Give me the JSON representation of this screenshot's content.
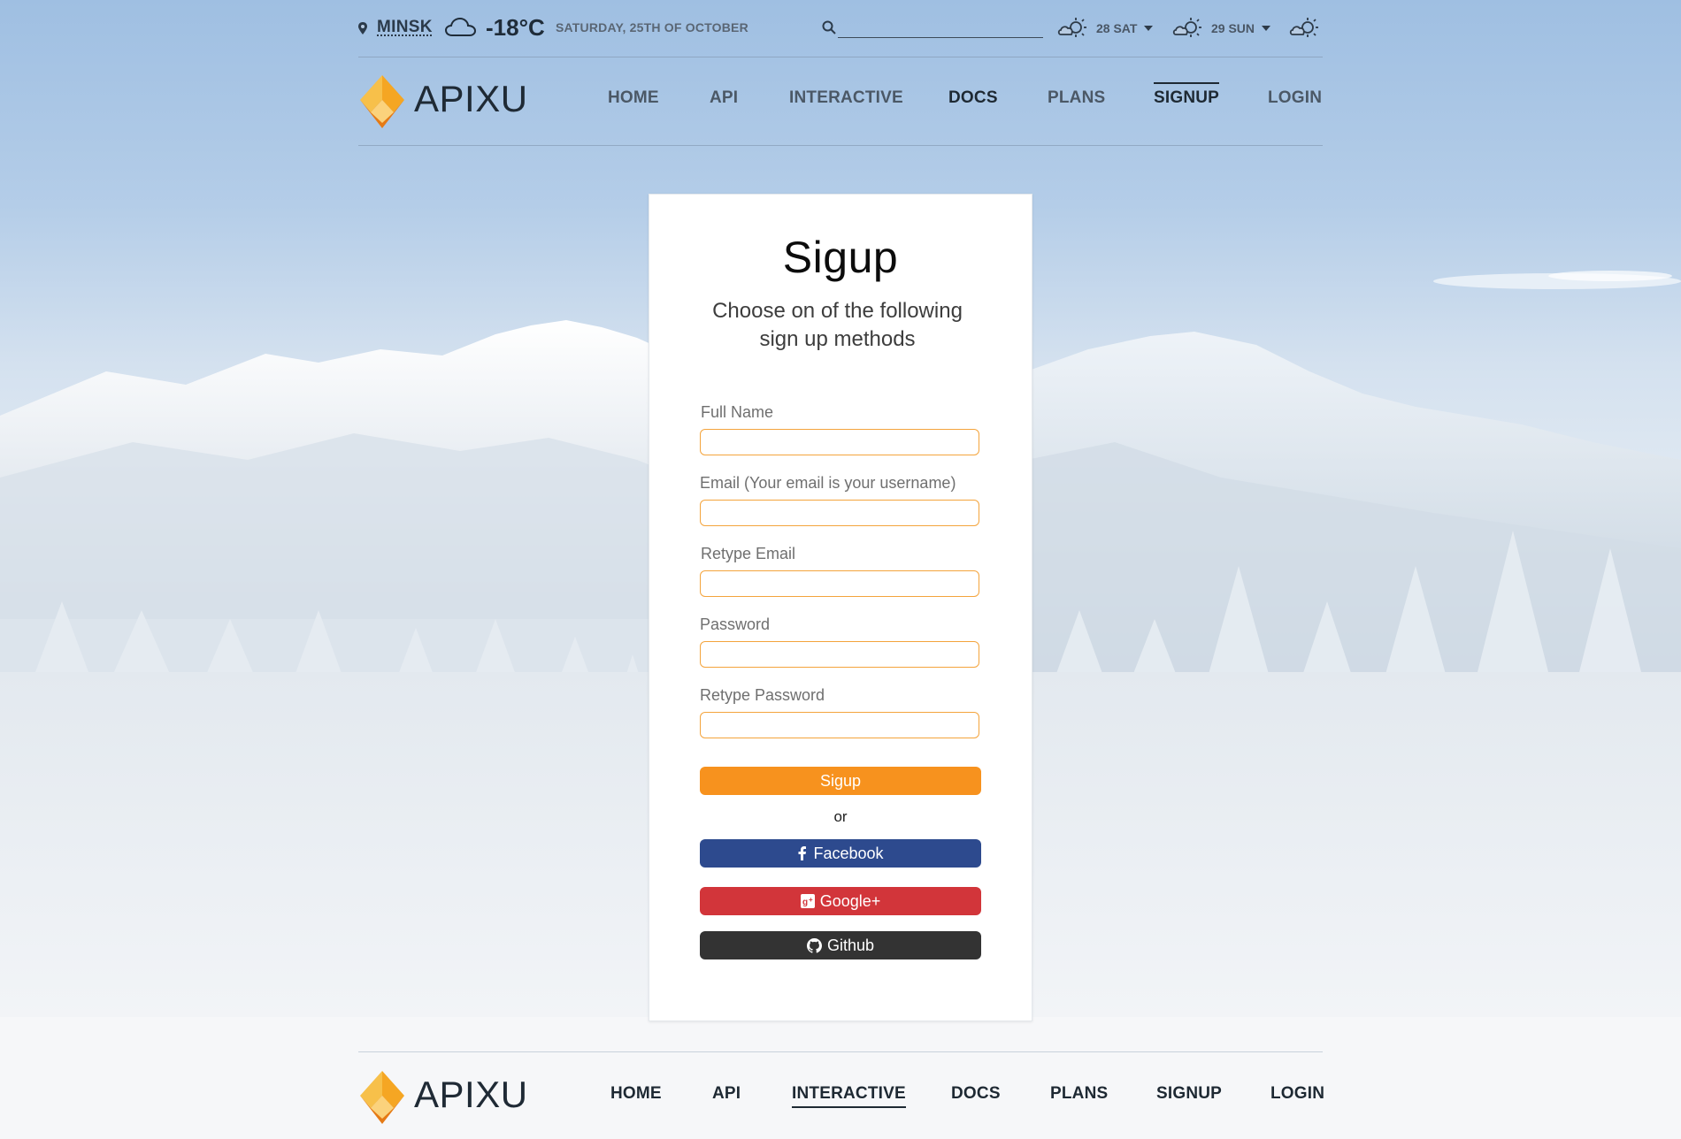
{
  "weather": {
    "city": "MINSK",
    "temperature": "-18°C",
    "date": "SATURDAY, 25TH OF OCTOBER",
    "forecast": [
      {
        "label": "28 SAT",
        "icon": "partly-sunny-icon"
      },
      {
        "label": "29 SUN",
        "icon": "partly-sunny-icon"
      },
      {
        "label": "",
        "icon": "partly-sunny-icon"
      }
    ],
    "current_icon": "cloud-icon"
  },
  "search": {
    "placeholder": ""
  },
  "brand": {
    "name": "APIXU"
  },
  "nav": {
    "items": [
      {
        "label": "HOME"
      },
      {
        "label": "API"
      },
      {
        "label": "INTERACTIVE"
      },
      {
        "label": "DOCS"
      },
      {
        "label": "PLANS"
      },
      {
        "label": "SIGNUP"
      },
      {
        "label": "LOGIN"
      }
    ]
  },
  "signup": {
    "title": "Sigup",
    "subtitle_line1": "Choose on of the following",
    "subtitle_line2": "sign up methods",
    "fields": [
      {
        "label": "Full Name",
        "value": ""
      },
      {
        "label": "Email (Your email is your username)",
        "value": ""
      },
      {
        "label": "Retype Email",
        "value": ""
      },
      {
        "label": "Password",
        "value": ""
      },
      {
        "label": "Retype Password",
        "value": ""
      }
    ],
    "submit_label": "Sigup",
    "or_label": "or",
    "social": [
      {
        "label": "Facebook"
      },
      {
        "label": "Google+"
      },
      {
        "label": "Github"
      }
    ]
  },
  "colors": {
    "accent": "#f7921e",
    "facebook": "#2d4a8e",
    "google": "#d2353a",
    "github": "#333333",
    "input_border": "#f4a43c"
  }
}
